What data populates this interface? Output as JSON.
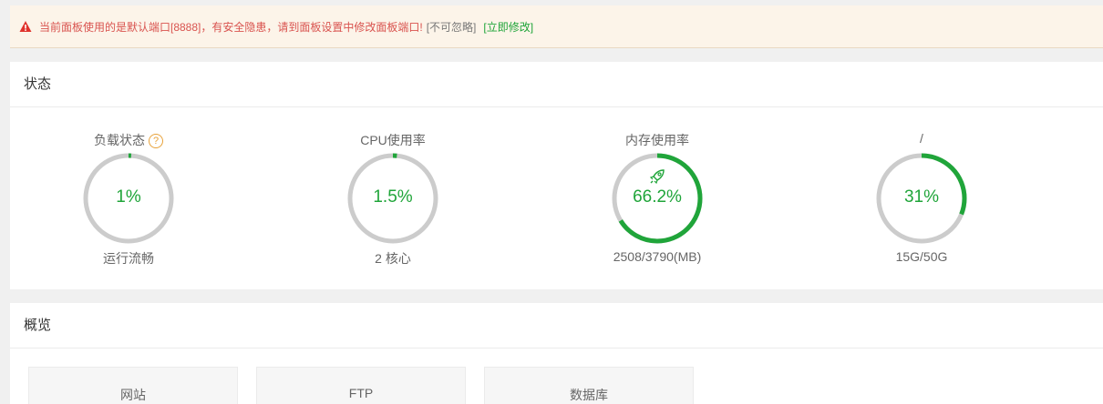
{
  "alert": {
    "message": "当前面板使用的是默认端口[8888]，有安全隐患，请到面板设置中修改面板端口!",
    "ignore_label": "[不可忽略]",
    "fix_label": "[立即修改]"
  },
  "status_panel": {
    "title": "状态",
    "gauges": [
      {
        "title": "负载状态",
        "value_text": "1%",
        "percent": 1,
        "sub": "运行流畅",
        "has_help": true,
        "help_symbol": "?"
      },
      {
        "title": "CPU使用率",
        "value_text": "1.5%",
        "percent": 1.5,
        "sub": "2 核心"
      },
      {
        "title": "内存使用率",
        "value_text": "66.2%",
        "percent": 66.2,
        "sub": "2508/3790(MB)",
        "icon": "rocket-icon"
      },
      {
        "title": "/",
        "value_text": "31%",
        "percent": 31,
        "sub": "15G/50G"
      }
    ]
  },
  "overview_panel": {
    "title": "概览",
    "tiles": [
      {
        "label": "网站"
      },
      {
        "label": "FTP"
      },
      {
        "label": "数据库"
      }
    ]
  },
  "colors": {
    "accent": "#20a53a",
    "track": "#cccccc",
    "warning_text": "#d9534f",
    "banner_bg": "#fcf4e9"
  }
}
